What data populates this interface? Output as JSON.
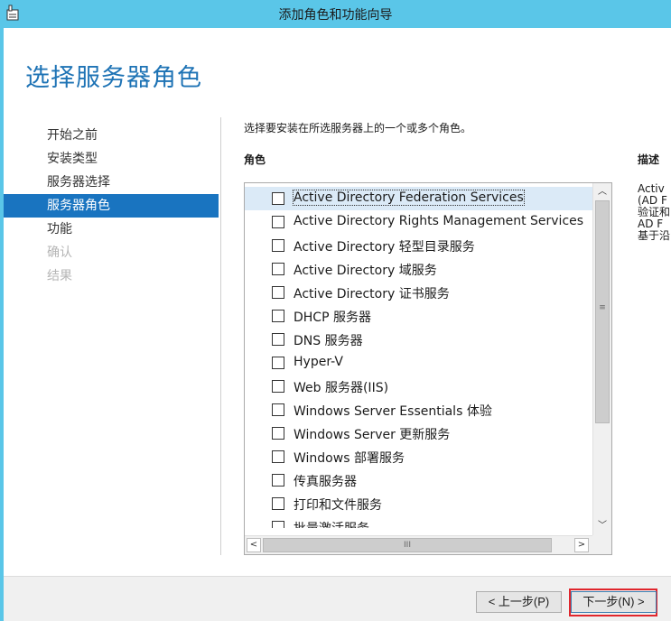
{
  "window": {
    "title": "添加角色和功能向导",
    "titlebar_color": "#5ac6e8"
  },
  "page": {
    "title": "选择服务器角色",
    "title_color": "#1e73b5"
  },
  "nav": {
    "items": [
      {
        "label": "开始之前",
        "state": "normal"
      },
      {
        "label": "安装类型",
        "state": "normal"
      },
      {
        "label": "服务器选择",
        "state": "normal"
      },
      {
        "label": "服务器角色",
        "state": "active"
      },
      {
        "label": "功能",
        "state": "normal"
      },
      {
        "label": "确认",
        "state": "disabled"
      },
      {
        "label": "结果",
        "state": "disabled"
      }
    ],
    "active_color": "#1974c0"
  },
  "main": {
    "instruction": "选择要安装在所选服务器上的一个或多个角色。",
    "roles_header": "角色",
    "description_header": "描述",
    "roles": [
      {
        "label": "Active Directory Federation Services",
        "checked": false,
        "selected": true
      },
      {
        "label": "Active Directory Rights Management Services",
        "checked": false
      },
      {
        "label": "Active Directory 轻型目录服务",
        "checked": false
      },
      {
        "label": "Active Directory 域服务",
        "checked": false
      },
      {
        "label": "Active Directory 证书服务",
        "checked": false
      },
      {
        "label": "DHCP 服务器",
        "checked": false
      },
      {
        "label": "DNS 服务器",
        "checked": false
      },
      {
        "label": "Hyper-V",
        "checked": false
      },
      {
        "label": "Web 服务器(IIS)",
        "checked": false
      },
      {
        "label": "Windows Server Essentials 体验",
        "checked": false
      },
      {
        "label": "Windows Server 更新服务",
        "checked": false
      },
      {
        "label": "Windows 部署服务",
        "checked": false
      },
      {
        "label": "传真服务器",
        "checked": false
      },
      {
        "label": "打印和文件服务",
        "checked": false
      },
      {
        "label": "批量激活服务",
        "checked": false
      }
    ],
    "description_lines": [
      "Activ",
      "(AD F",
      "验证和",
      "AD F",
      "基于沿"
    ]
  },
  "footer": {
    "prev_label": "< 上一步(P)",
    "next_label": "下一步(N) >",
    "highlight_color": "#e0262d"
  }
}
